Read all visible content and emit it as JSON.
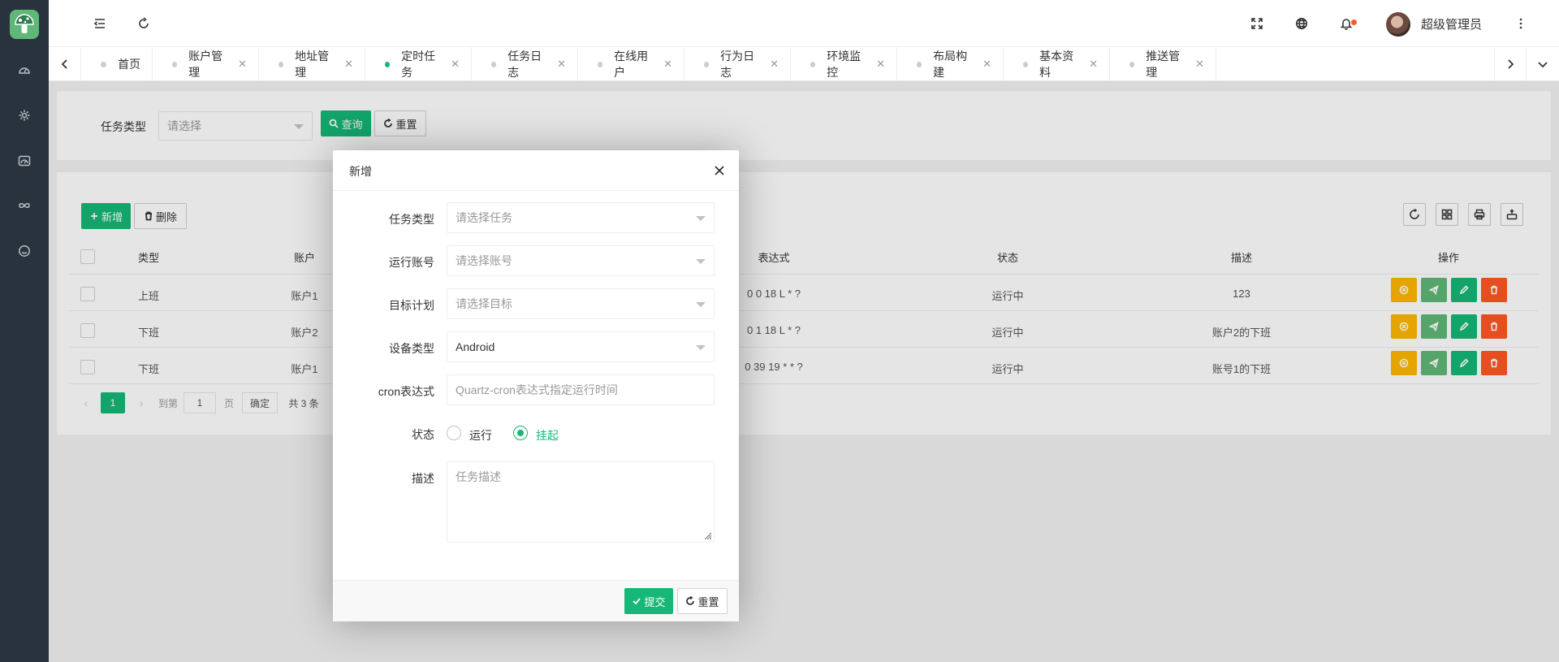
{
  "sidebar": {
    "logo_icon": "mushroom-logo",
    "items": [
      {
        "icon": "dashboard-icon"
      },
      {
        "icon": "gear-icon"
      },
      {
        "icon": "gauge-icon"
      },
      {
        "icon": "infinity-icon"
      },
      {
        "icon": "smile-icon"
      }
    ]
  },
  "header": {
    "menu_toggle_icon": "menu-fold-icon",
    "refresh_icon": "refresh-icon",
    "fullscreen_icon": "fullscreen-icon",
    "language_icon": "globe-icon",
    "notification_icon": "bell-icon",
    "username": "超级管理员",
    "more_icon": "more-vertical-icon"
  },
  "tabs": [
    {
      "label": "首页",
      "closable": false,
      "active": false
    },
    {
      "label": "账户管理",
      "closable": true,
      "active": false
    },
    {
      "label": "地址管理",
      "closable": true,
      "active": false
    },
    {
      "label": "定时任务",
      "closable": true,
      "active": true
    },
    {
      "label": "任务日志",
      "closable": true,
      "active": false
    },
    {
      "label": "在线用户",
      "closable": true,
      "active": false
    },
    {
      "label": "行为日志",
      "closable": true,
      "active": false
    },
    {
      "label": "环境监控",
      "closable": true,
      "active": false
    },
    {
      "label": "布局构建",
      "closable": true,
      "active": false
    },
    {
      "label": "基本资料",
      "closable": true,
      "active": false
    },
    {
      "label": "推送管理",
      "closable": true,
      "active": false
    }
  ],
  "search": {
    "task_type_label": "任务类型",
    "task_type_placeholder": "请选择",
    "query_button": "查询",
    "reset_button": "重置"
  },
  "toolbar": {
    "add_button": "新增",
    "delete_button": "删除"
  },
  "table": {
    "columns": [
      "类型",
      "账户",
      "表达式",
      "状态",
      "描述",
      "操作"
    ],
    "rows": [
      {
        "type": "上班",
        "account": "账户1",
        "expression": "0 0 18 L * ?",
        "status": "运行中",
        "description": "123"
      },
      {
        "type": "下班",
        "account": "账户2",
        "expression": "0 1 18 L * ?",
        "status": "运行中",
        "description": "账户2的下班"
      },
      {
        "type": "下班",
        "account": "账户1",
        "expression": "0 39 19 * * ?",
        "status": "运行中",
        "description": "账号1的下班"
      }
    ]
  },
  "pager": {
    "current": "1",
    "goto_label": "到第",
    "page_input": "1",
    "page_unit": "页",
    "confirm": "确定",
    "total": "共 3 条"
  },
  "dialog": {
    "title": "新增",
    "task_type_label": "任务类型",
    "task_type_placeholder": "请选择任务",
    "account_label": "运行账号",
    "account_placeholder": "请选择账号",
    "target_label": "目标计划",
    "target_placeholder": "请选择目标",
    "device_label": "设备类型",
    "device_value": "Android",
    "cron_label": "cron表达式",
    "cron_placeholder": "Quartz-cron表达式指定运行时间",
    "status_label": "状态",
    "status_run": "运行",
    "status_suspend": "挂起",
    "status_selected": "挂起",
    "desc_label": "描述",
    "desc_placeholder": "任务描述",
    "submit_button": "提交",
    "reset_button": "重置"
  },
  "colors": {
    "primary": "#16b777",
    "sidebar": "#28333e",
    "warn": "#ffb800",
    "danger": "#ff5722"
  }
}
